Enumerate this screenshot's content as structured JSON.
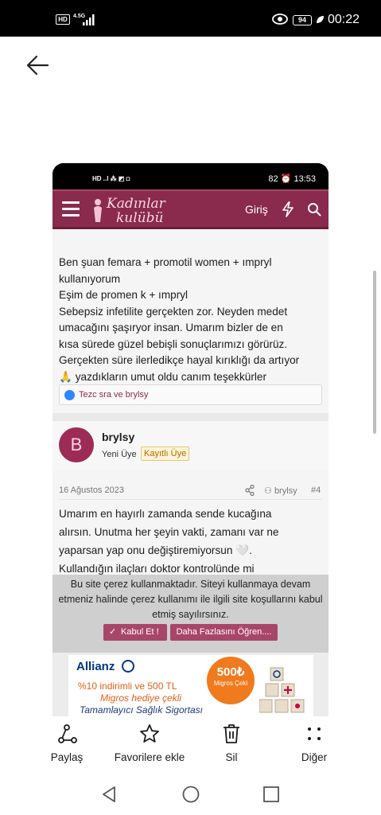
{
  "status_bar": {
    "hd": "HD",
    "network": "4.5G",
    "battery": "94",
    "time": "00:22"
  },
  "inner_status": {
    "left": "HD ..l ⁂ ◩ ◘",
    "right": "82 ⏰ 13:53"
  },
  "site": {
    "logo_line1": "Kadınlar",
    "logo_line2": "kulübü",
    "login": "Giriş"
  },
  "post1": {
    "cut_text": "...",
    "lines": [
      "Ben şuan femara + promotil women + ımpryl",
      "kullanıyorum",
      "Eşim de promen k + ımpryl",
      "Sebepsiz infetilite gerçekten zor. Neyden medet",
      "umacağını şaşıryor insan. Umarım bizler de en",
      "kısa sürede güzel bebişli sonuçlarımızı görürüz.",
      "Gerçekten süre ilerledikçe hayal kırıklığı da artıyor",
      "yazdıkların umut oldu canım teşekkürler"
    ],
    "emoji": "🙏",
    "reactions": "Tezc sra ve brylsy"
  },
  "user": {
    "avatar_letter": "B",
    "name": "brylsy",
    "title": "Yeni Üye",
    "badge": "Kayıtlı Üye"
  },
  "meta": {
    "date": "16 Ağustos 2023",
    "user": "brylsy",
    "number": "#4"
  },
  "post2": {
    "lines": [
      "Umarım en hayırlı zamanda sende kucağına",
      "alırsın. Unutma her şeyin vakti, zamanı var ne",
      "yaparsan yap onu değiştiremiyorsun 🤍.",
      "Kullandığın ilaçları doktor kontrolünde mi"
    ]
  },
  "cookie": {
    "message": "Bu site çerez kullanmaktadır. Siteyi kullanmaya devam etmeniz halinde çerez kullanımı ile ilgili site koşullarını kabul etmiş sayılırsınız.",
    "accept": "Kabul Et !",
    "more": "Daha Fazlasını Öğren...."
  },
  "ad": {
    "brand": "Allianz",
    "line1": "%10 indirimli ve 500 TL",
    "line2": "Migros hediye çekli",
    "line3": "Tamamlayıcı Sağlık Sigortası",
    "amount": "500₺",
    "circle_sub": "Migros Çeki"
  },
  "actions": [
    {
      "label": "Paylaş",
      "icon": "share-icon"
    },
    {
      "label": "Favorilere ekle",
      "icon": "star-icon"
    },
    {
      "label": "Sil",
      "icon": "trash-icon"
    },
    {
      "label": "Diğer",
      "icon": "more-icon"
    }
  ],
  "colors": {
    "brand": "#8a2a4d",
    "button": "#a8466a"
  }
}
